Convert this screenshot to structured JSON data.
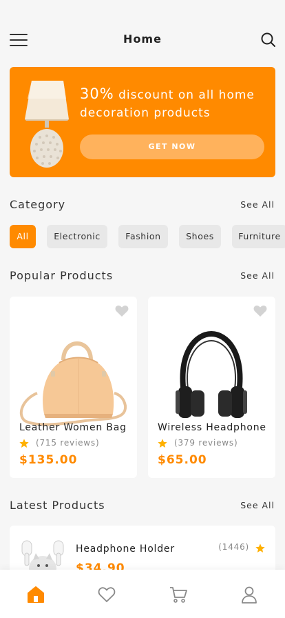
{
  "header": {
    "title": "Home"
  },
  "banner": {
    "percent": "30%",
    "text": "discount on all home decoration products",
    "button_label": "GET NOW"
  },
  "category": {
    "title": "Category",
    "see_all": "See All",
    "chips": [
      "All",
      "Electronic",
      "Fashion",
      "Shoes",
      "Furniture"
    ],
    "active": "All"
  },
  "popular": {
    "title": "Popular Products",
    "see_all": "See All",
    "items": [
      {
        "name": "Leather Women Bag",
        "reviews": "(715 reviews)",
        "price": "$135.00",
        "image": "handbag"
      },
      {
        "name": "Wireless Headphone",
        "reviews": "(379 reviews)",
        "price": "$65.00",
        "image": "headphones"
      }
    ]
  },
  "latest": {
    "title": "Latest Products",
    "see_all": "See All",
    "items": [
      {
        "name": "Headphone Holder",
        "price": "$34.90",
        "count": "(1446)",
        "image": "cat-earbud-holder"
      }
    ]
  },
  "tabbar": [
    "home-icon",
    "heart-icon",
    "cart-icon",
    "user-icon"
  ],
  "colors": {
    "accent": "#ff8a00",
    "accent_light": "#ffb25c",
    "star": "#ffb000"
  }
}
